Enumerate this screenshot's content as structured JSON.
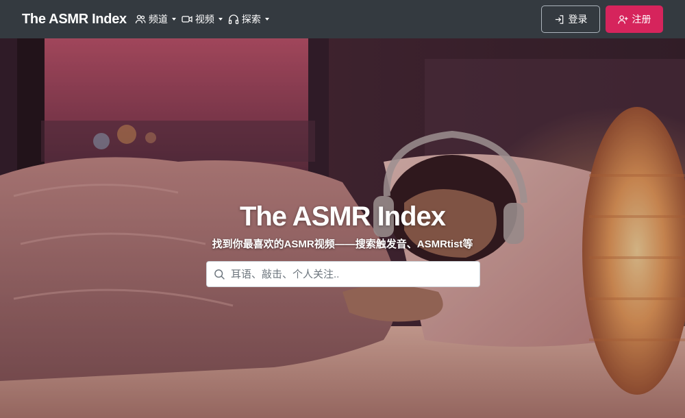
{
  "nav": {
    "brand": "The ASMR Index",
    "items": [
      {
        "label": "频道",
        "icon": "users-icon"
      },
      {
        "label": "视频",
        "icon": "video-camera-icon"
      },
      {
        "label": "探索",
        "icon": "headphones-icon"
      }
    ],
    "login_label": "登录",
    "register_label": "注册"
  },
  "hero": {
    "title": "The ASMR Index",
    "subtitle": "找到你最喜欢的ASMR视频——搜索触发音、ASMRtist等",
    "search_placeholder": "耳语、敲击、个人关注.."
  },
  "colors": {
    "navbar": "#343a40",
    "register_button": "#d6245c",
    "login_border": "#adb5bd"
  }
}
